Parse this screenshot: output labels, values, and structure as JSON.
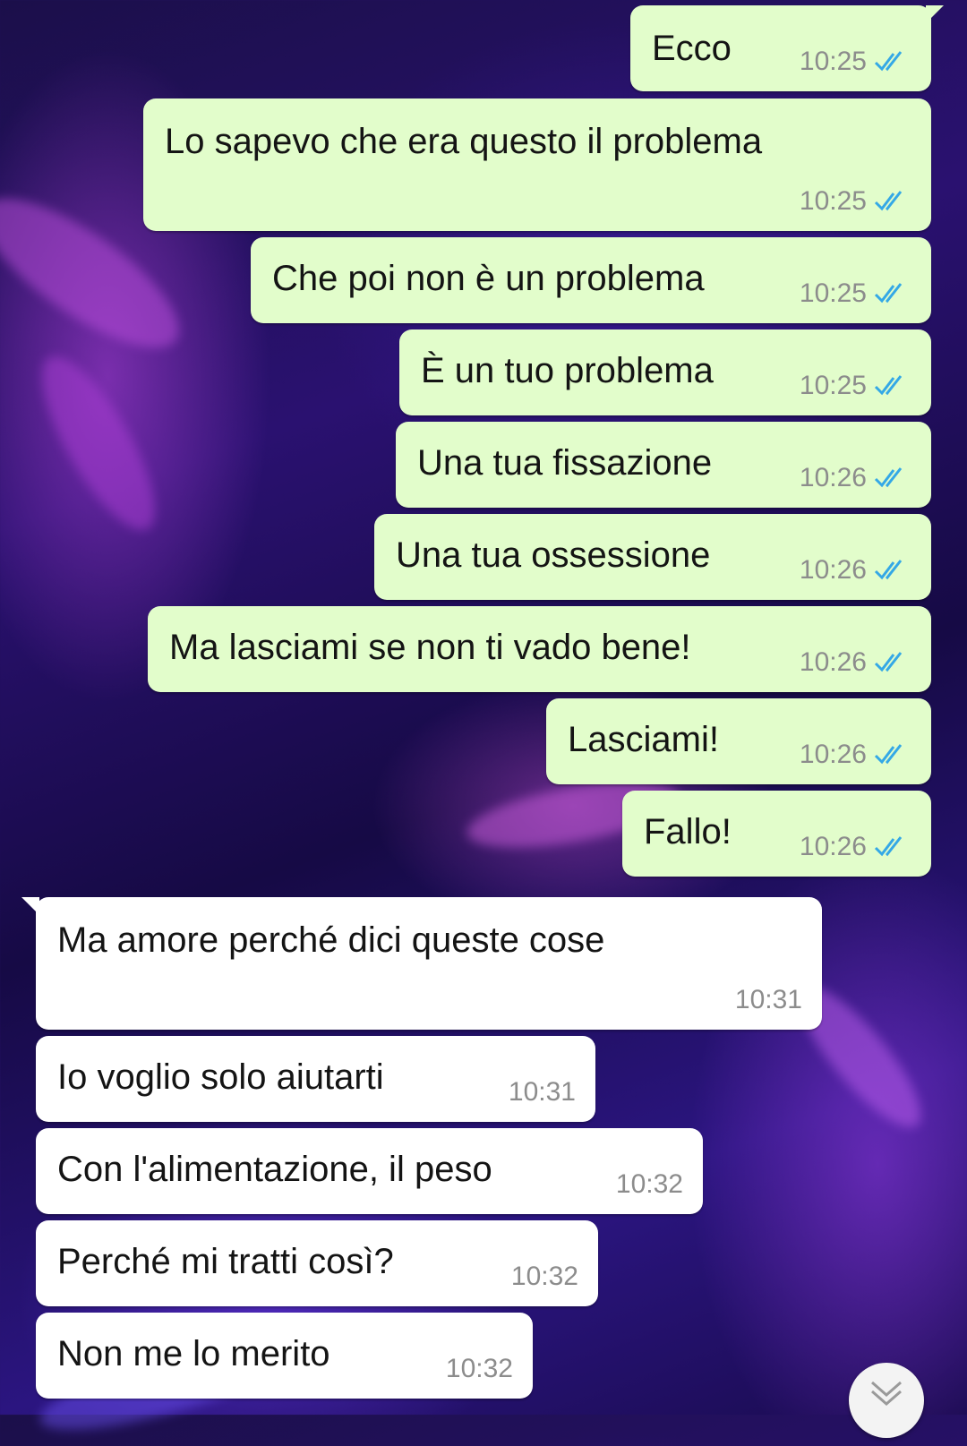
{
  "outgoing": [
    {
      "text": "Ecco",
      "time": "10:25",
      "status": "read"
    },
    {
      "text": "Lo sapevo che era questo il problema",
      "time": "10:25",
      "status": "read"
    },
    {
      "text": "Che poi non è un problema",
      "time": "10:25",
      "status": "read"
    },
    {
      "text": "È un tuo problema",
      "time": "10:25",
      "status": "read"
    },
    {
      "text": "Una tua fissazione",
      "time": "10:26",
      "status": "read"
    },
    {
      "text": "Una tua ossessione",
      "time": "10:26",
      "status": "read"
    },
    {
      "text": "Ma lasciami se non ti vado bene!",
      "time": "10:26",
      "status": "read"
    },
    {
      "text": "Lasciami!",
      "time": "10:26",
      "status": "read"
    },
    {
      "text": "Fallo!",
      "time": "10:26",
      "status": "read"
    }
  ],
  "incoming": [
    {
      "text": "Ma amore perché dici queste cose",
      "time": "10:31"
    },
    {
      "text": "Io voglio solo aiutarti",
      "time": "10:31"
    },
    {
      "text": "Con l'alimentazione, il peso",
      "time": "10:32"
    },
    {
      "text": "Perché mi tratti così?",
      "time": "10:32"
    },
    {
      "text": "Non me lo merito",
      "time": "10:32"
    }
  ],
  "colors": {
    "outgoing_bubble": "#e2fdcb",
    "incoming_bubble": "#ffffff",
    "read_ticks": "#34a8e6",
    "timestamp": "#8c8c8c"
  },
  "icons": {
    "read_status": "double-check-icon",
    "scroll_down": "chevron-down-icon"
  }
}
